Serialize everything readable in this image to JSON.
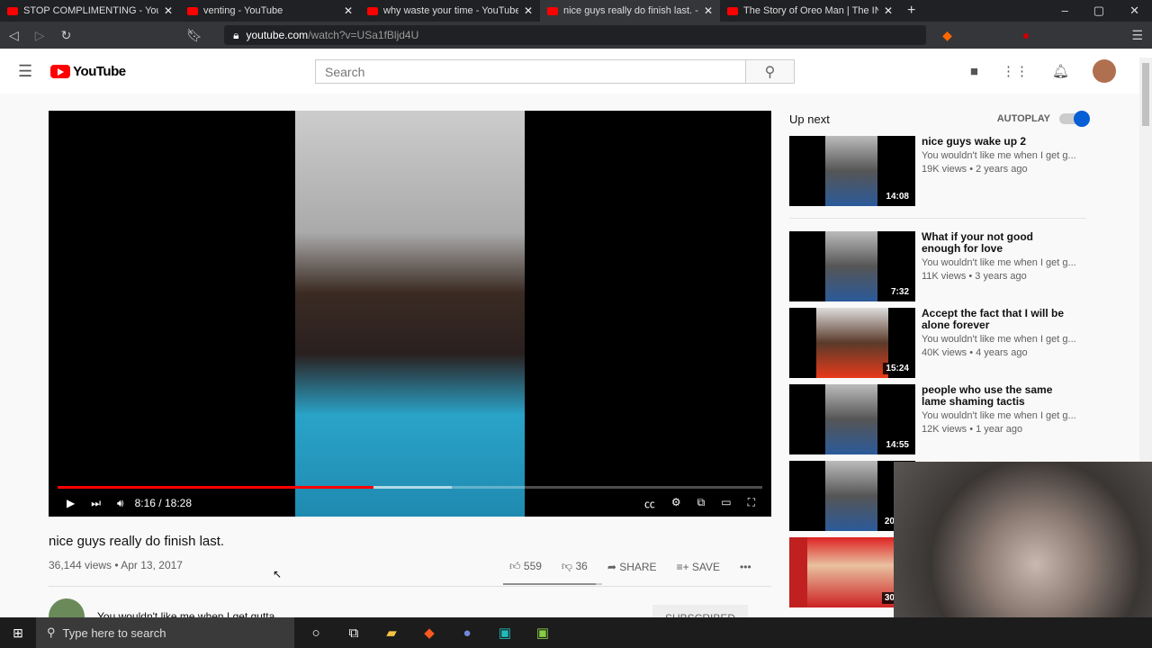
{
  "browser": {
    "tabs": [
      {
        "label": "STOP COMPLIMENTING - YouTube",
        "active": false
      },
      {
        "label": "venting - YouTube",
        "active": false
      },
      {
        "label": "why waste your time - YouTube",
        "active": false
      },
      {
        "label": "nice guys really do finish last. - YouTube",
        "active": true
      },
      {
        "label": "The Story of Oreo Man | The INCEL",
        "active": false
      }
    ],
    "url_host": "youtube.com",
    "url_path": "/watch?v=USa1fBljd4U"
  },
  "header": {
    "logo": "YouTube",
    "search_placeholder": "Search"
  },
  "player": {
    "time": "8:16 / 18:28",
    "progress": 0.448,
    "buffered": 0.56
  },
  "video": {
    "title": "nice guys really do finish last.",
    "meta": "36,144 views • Apr 13, 2017",
    "likes": "559",
    "dislikes": "36",
    "share": "SHARE",
    "save": "SAVE",
    "like_ratio": 0.94,
    "channel": "You wouldn't like me when I get gutta",
    "subscribe": "SUBSCRIBED"
  },
  "upnext": {
    "label": "Up next",
    "autoplay": "AUTOPLAY",
    "items": [
      {
        "title": "nice guys wake up 2",
        "channel": "You wouldn't like me when I get g...",
        "meta": "19K views • 2 years ago",
        "duration": "14:08"
      },
      {
        "title": "What if your not good enough for love",
        "channel": "You wouldn't like me when I get g...",
        "meta": "11K views • 3 years ago",
        "duration": "7:32"
      },
      {
        "title": "Accept the fact that I will be alone forever",
        "channel": "You wouldn't like me when I get g...",
        "meta": "40K views • 4 years ago",
        "duration": "15:24"
      },
      {
        "title": "people who use the same lame shaming tactis",
        "channel": "You wouldn't like me when I get g...",
        "meta": "12K views • 1 year ago",
        "duration": "14:55"
      },
      {
        "duration": "20"
      },
      {
        "duration": "30"
      }
    ]
  },
  "taskbar": {
    "search_placeholder": "Type here to search"
  }
}
